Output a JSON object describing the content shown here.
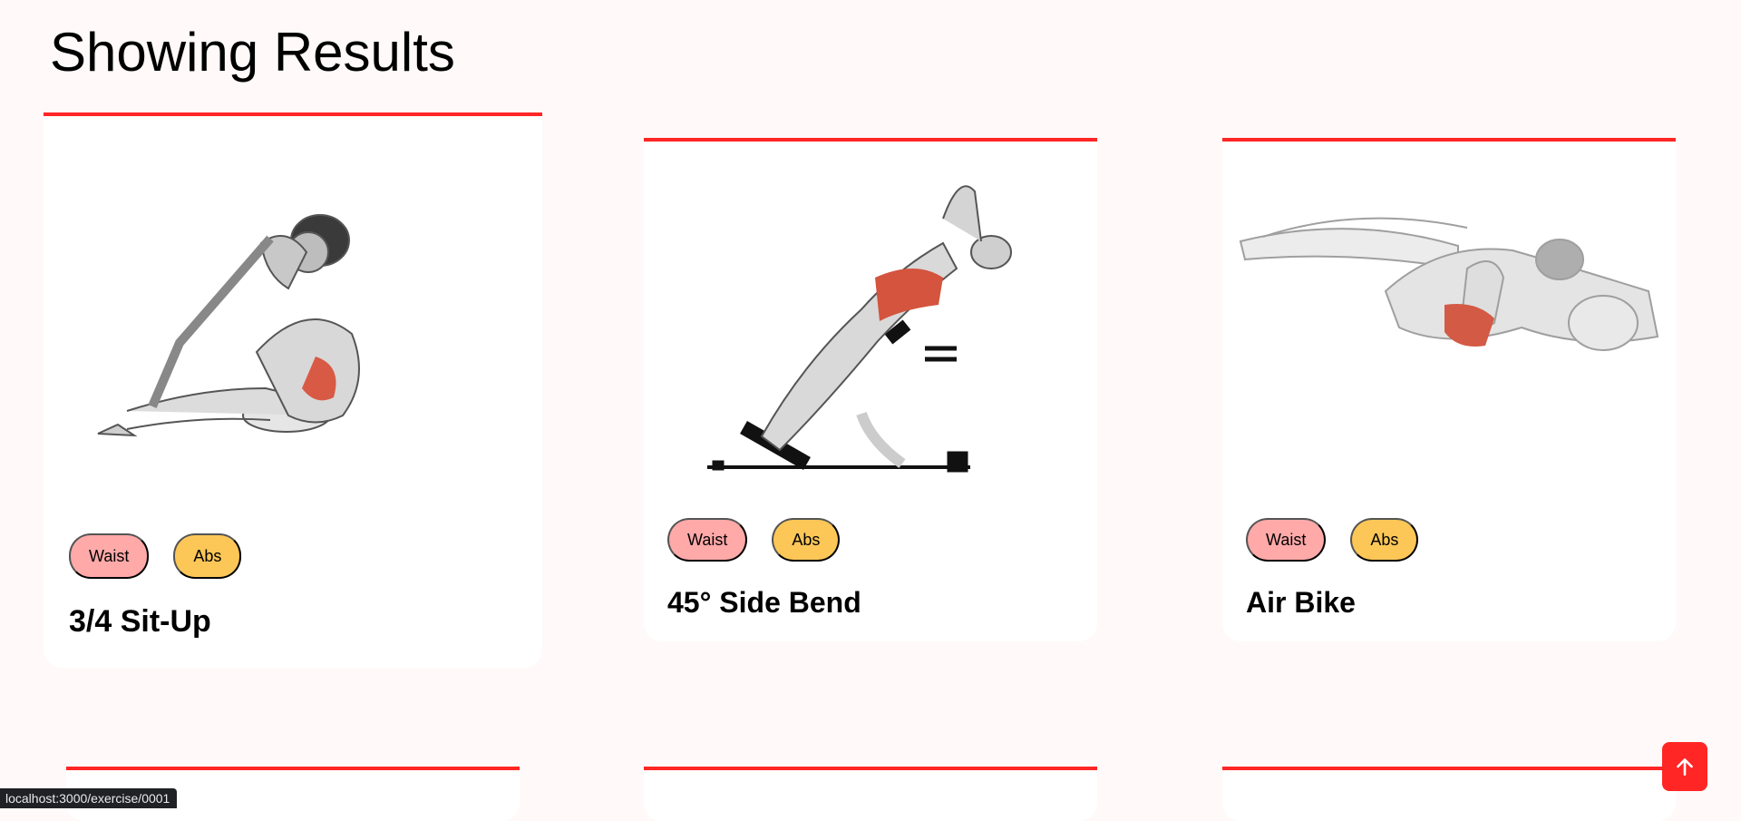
{
  "page": {
    "heading": "Showing Results"
  },
  "exercises": [
    {
      "name": "3/4 Sit-Up",
      "body_part": "Waist",
      "target": "Abs"
    },
    {
      "name": "45° Side Bend",
      "body_part": "Waist",
      "target": "Abs"
    },
    {
      "name": "Air Bike",
      "body_part": "Waist",
      "target": "Abs"
    }
  ],
  "scroll_top": {
    "icon": "arrow-up-icon"
  },
  "status_bar": {
    "url": "localhost:3000/exercise/0001"
  },
  "colors": {
    "accent": "#ff2625",
    "body_part_tag": "#ffa9a9",
    "target_tag": "#fcc757",
    "background": "#fff9f9"
  }
}
